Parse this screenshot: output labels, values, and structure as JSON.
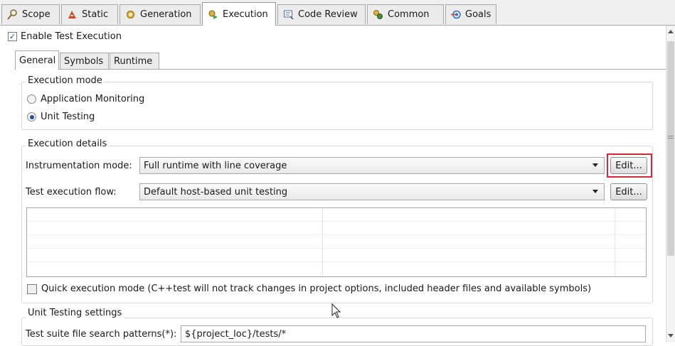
{
  "tabs": [
    {
      "label": "Scope",
      "icon": "scope-icon"
    },
    {
      "label": "Static",
      "icon": "static-icon"
    },
    {
      "label": "Generation",
      "icon": "generation-icon"
    },
    {
      "label": "Execution",
      "icon": "execution-icon",
      "active": true
    },
    {
      "label": "Code Review",
      "icon": "code-review-icon"
    },
    {
      "label": "Common",
      "icon": "common-icon"
    },
    {
      "label": "Goals",
      "icon": "goals-icon"
    }
  ],
  "enable_test_execution": {
    "label": "Enable Test Execution",
    "checked": true
  },
  "subtabs": [
    "General",
    "Symbols",
    "Runtime"
  ],
  "execution_mode": {
    "legend": "Execution mode",
    "options": [
      "Application Monitoring",
      "Unit Testing"
    ],
    "selected": "Unit Testing"
  },
  "execution_details": {
    "legend": "Execution details",
    "instrumentation_label": "Instrumentation mode:",
    "instrumentation_value": "Full runtime with line coverage",
    "instrumentation_edit": "Edit...",
    "flow_label": "Test execution flow:",
    "flow_value": "Default host-based unit testing",
    "flow_edit": "Edit...",
    "quick_mode_label": "Quick execution mode (C++test will not track changes in project options, included header files and available symbols)",
    "quick_mode_checked": false
  },
  "unit_testing_settings": {
    "legend": "Unit Testing settings",
    "pattern_label": "Test suite file search patterns(*):",
    "pattern_value": "${project_loc}/tests/*"
  },
  "colors": {
    "highlight": "#d9263f",
    "tab_border": "#a8a8a8"
  }
}
